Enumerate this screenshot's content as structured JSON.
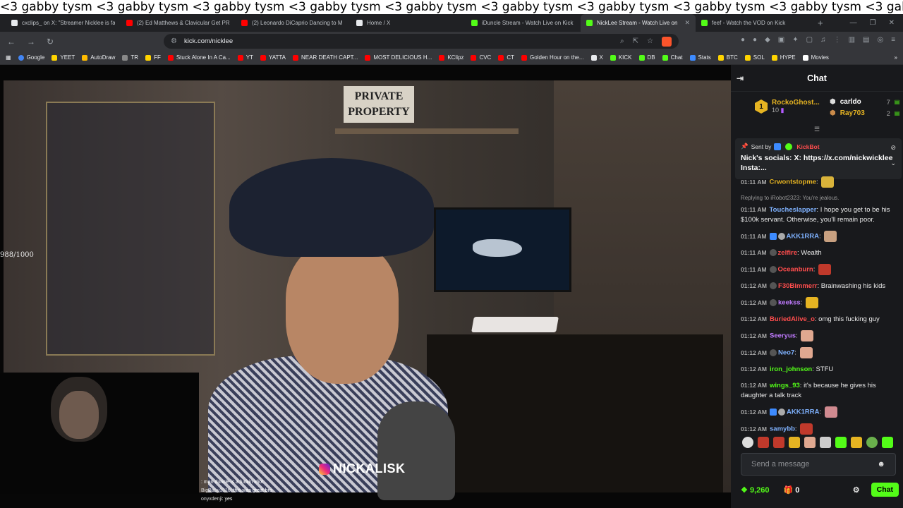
{
  "ticker": "<3 gabby tysm <3 gabby tysm <3 gabby tysm <3 gabby tysm <3 gabby tysm <3 gabby tysm <3 gabby tysm <3 gabby tysm <3 gabby tysm <3 gabby tysm <3 gab",
  "tabs": [
    {
      "title": "cxclips_ on X: \"Streamer Nicklee is fa",
      "color": "#000000"
    },
    {
      "title": "(2) Ed Matthews & Clavicular Get PR",
      "color": "#ff0000"
    },
    {
      "title": "(2) Leonardo DiCaprio Dancing to M",
      "color": "#ff0000"
    },
    {
      "title": "Home / X",
      "color": "#000000"
    },
    {
      "title": "iDuncle Stream - Watch Live on Kick",
      "color": "#53fc18"
    },
    {
      "title": "NickLee Stream - Watch Live on",
      "color": "#53fc18"
    },
    {
      "title": "feef - Watch the VOD on Kick",
      "color": "#53fc18"
    }
  ],
  "new_tab": "+",
  "url": "kick.com/nicklee",
  "bookmarks": [
    {
      "label": "Google",
      "color": "#4285f4"
    },
    {
      "label": "YEET",
      "color": "#ffd400"
    },
    {
      "label": "AutoDraw",
      "color": "#ffbb00"
    },
    {
      "label": "TR",
      "color": "#888888"
    },
    {
      "label": "FF",
      "color": "#ffd400"
    },
    {
      "label": "Stuck Alone In A Ca...",
      "color": "#ff0000"
    },
    {
      "label": "YT",
      "color": "#ff0000"
    },
    {
      "label": "YATTA",
      "color": "#ff0000"
    },
    {
      "label": "NEAR DEATH CAPT...",
      "color": "#ff0000"
    },
    {
      "label": "MOST DELICIOUS H...",
      "color": "#ff0000"
    },
    {
      "label": "KClipz",
      "color": "#ff0000"
    },
    {
      "label": "CVC",
      "color": "#ff0000"
    },
    {
      "label": "CT",
      "color": "#ff0000"
    },
    {
      "label": "Golden Hour on the...",
      "color": "#ff0000"
    },
    {
      "label": "X",
      "color": "#000000"
    },
    {
      "label": "KICK",
      "color": "#53fc18"
    },
    {
      "label": "DB",
      "color": "#53fc18"
    },
    {
      "label": "Chat",
      "color": "#53fc18"
    },
    {
      "label": "Stats",
      "color": "#3d8bff"
    },
    {
      "label": "BTC",
      "color": "#ffd400"
    },
    {
      "label": "SOL",
      "color": "#ffd400"
    },
    {
      "label": "HYPE",
      "color": "#ffd400"
    },
    {
      "label": "Movies",
      "color": "#ffffff"
    }
  ],
  "video": {
    "counter": "988/1000",
    "sign": "PRIVATE PROPERTY",
    "handle": "NICKALISK",
    "mini_chat": [
      {
        "user": "",
        "text": ": man duncle is a fuckin idiot"
      },
      {
        "user": "BigBaby1016",
        "text": ": this was great bro"
      },
      {
        "user": "onyxdenji",
        "text": ": yes"
      }
    ]
  },
  "chat": {
    "title": "Chat",
    "leaders": {
      "first": {
        "rank": "1",
        "name": "RockoGhost...",
        "count": "10"
      },
      "second": {
        "name": "carldo",
        "count": "7"
      },
      "third": {
        "name": "Ray703",
        "count": "2"
      }
    },
    "pinned": {
      "sent_by": "Sent by",
      "bot": "KickBot",
      "message": "Nick's socials: X: https://x.com/nickwicklee Insta:..."
    },
    "messages": [
      {
        "time": "01:11 AM",
        "user": "Crwontstopme",
        "user_color": "#e6b422",
        "text": "",
        "emote": "#d9b33a"
      },
      {
        "reply": "Replying to iRobot2323: You're jealous."
      },
      {
        "time": "01:11 AM",
        "user": "Toucheslapper",
        "user_color": "#7fb2ff",
        "text": ": I hope you get to be his $100k servant. Otherwise, you'll remain poor."
      },
      {
        "time": "01:11 AM",
        "user": "AKK1RRA",
        "user_color": "#7fb2ff",
        "text": ":",
        "emote": "#c8a080"
      },
      {
        "time": "01:11 AM",
        "user": "zelfire",
        "user_color": "#ff4d4d",
        "text": ": Wealth"
      },
      {
        "time": "01:11 AM",
        "user": "Oceanburn",
        "user_color": "#ff4d4d",
        "text": ":",
        "emote": "#c0392b"
      },
      {
        "time": "01:12 AM",
        "user": "F30Bimmerr",
        "user_color": "#ff4d4d",
        "text": ": Brainwashing his kids"
      },
      {
        "time": "01:12 AM",
        "user": "keekss",
        "user_color": "#c07bff",
        "text": ":",
        "emote": "#e6b422"
      },
      {
        "time": "01:12 AM",
        "user": "BuriedAlive_o",
        "user_color": "#ff4d4d",
        "text": ": omg this fucking guy"
      },
      {
        "time": "01:12 AM",
        "user": "Seeryus",
        "user_color": "#c07bff",
        "text": ":",
        "emote": "#e0a890"
      },
      {
        "time": "01:12 AM",
        "user": "Neo7",
        "user_color": "#7fb2ff",
        "text": ":",
        "emote": "#e0a890"
      },
      {
        "time": "01:12 AM",
        "user": "iron_johnson",
        "user_color": "#53fc18",
        "text": ": STFU"
      },
      {
        "time": "01:12 AM",
        "user": "wings_93",
        "user_color": "#53fc18",
        "text": ": it's because he gives his daughter a talk track"
      },
      {
        "time": "01:12 AM",
        "user": "AKK1RRA",
        "user_color": "#7fb2ff",
        "text": ":",
        "emote": "#d08a90"
      },
      {
        "time": "01:12 AM",
        "user": "samybb",
        "user_color": "#7fb2ff",
        "text": ":",
        "emote": "#c0392b"
      }
    ],
    "emote_bar": [
      "#dddddd",
      "#c0392b",
      "#c0392b",
      "#e6b422",
      "#e0a890",
      "#cccccc",
      "#53fc18",
      "#e6b422",
      "#6ab04c",
      "#53fc18"
    ],
    "input_placeholder": "Send a message",
    "points": "9,260",
    "gifts": "0",
    "send_label": "Chat"
  }
}
